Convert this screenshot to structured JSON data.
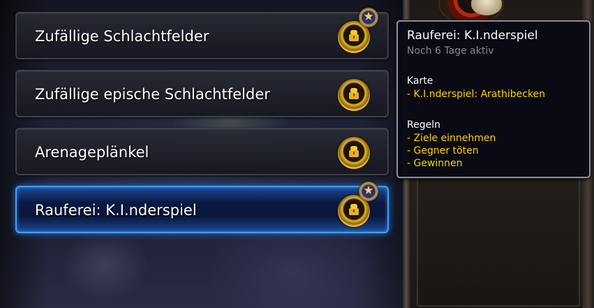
{
  "queues": [
    {
      "label": "Zufällige Schlachtfelder",
      "reward_icon": "gold-chest-icon",
      "bonus": true
    },
    {
      "label": "Zufällige epische Schlachtfelder",
      "reward_icon": "gold-chest-icon",
      "bonus": false
    },
    {
      "label": "Arenageplänkel",
      "reward_icon": "gold-chest-icon",
      "bonus": false
    },
    {
      "label": "Rauferei: K.I.nderspiel",
      "reward_icon": "gold-chest-icon",
      "bonus": true,
      "selected": true
    }
  ],
  "tooltip": {
    "title": "Rauferei: K.I.nderspiel",
    "subtitle": "Noch 6 Tage aktiv",
    "map_heading": "Karte",
    "map_lines": [
      "- K.I.nderspiel: Arathibecken"
    ],
    "rules_heading": "Regeln",
    "rules_lines": [
      "- Ziele einnehmen",
      "- Gegner töten",
      "- Gewinnen"
    ]
  },
  "colors": {
    "selected_border": "#3aa0ff",
    "tooltip_highlight": "#ffd100",
    "tooltip_muted": "#8a8a8a"
  }
}
